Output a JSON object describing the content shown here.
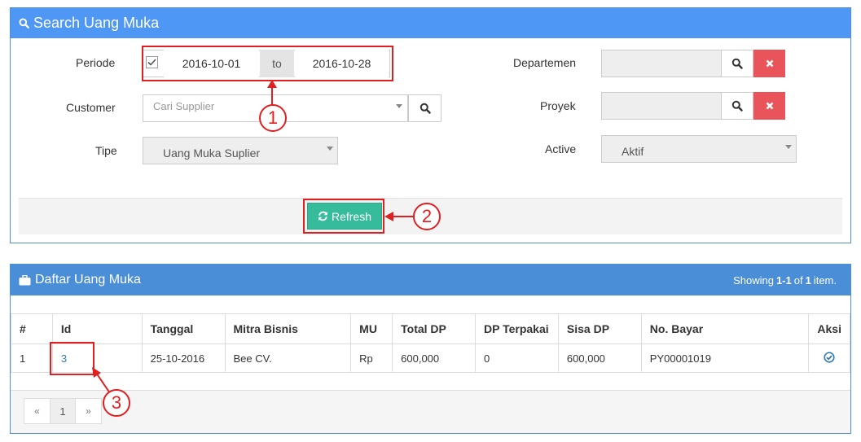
{
  "search_panel": {
    "title": "Search Uang Muka",
    "periode": {
      "label": "Periode",
      "checked": true,
      "from": "2016-10-01",
      "to_label": "to",
      "to": "2016-10-28"
    },
    "customer": {
      "label": "Customer",
      "placeholder": "Cari Supplier"
    },
    "tipe": {
      "label": "Tipe",
      "value": "Uang Muka Suplier"
    },
    "departemen": {
      "label": "Departemen",
      "value": ""
    },
    "proyek": {
      "label": "Proyek",
      "value": ""
    },
    "active": {
      "label": "Active",
      "value": "Aktif"
    },
    "refresh_label": "Refresh"
  },
  "list_panel": {
    "title": "Daftar Uang Muka",
    "summary": {
      "prefix": "Showing",
      "range": "1-1",
      "of": "of",
      "count": "1",
      "suffix": "item."
    },
    "columns": [
      "#",
      "Id",
      "Tanggal",
      "Mitra Bisnis",
      "MU",
      "Total DP",
      "DP Terpakai",
      "Sisa DP",
      "No. Bayar",
      "Aksi"
    ],
    "rows": [
      {
        "no": "1",
        "id": "3",
        "tanggal": "25-10-2016",
        "mitra": "Bee CV.",
        "mu": "Rp",
        "total_dp": "600,000",
        "dp_terpakai": "0",
        "sisa_dp": "600,000",
        "no_bayar": "PY00001019",
        "aksi_icon": "check-circle-icon"
      }
    ],
    "pagination": {
      "prev": "«",
      "current": "1",
      "next": "»"
    }
  },
  "annotations": {
    "one": "1",
    "two": "2",
    "three": "3",
    "color": "#e02020"
  },
  "colors": {
    "search_header": "#4e97f5",
    "list_header": "#4a8ed7",
    "refresh_button": "#37bc9b",
    "clear_button": "#e8545a"
  }
}
